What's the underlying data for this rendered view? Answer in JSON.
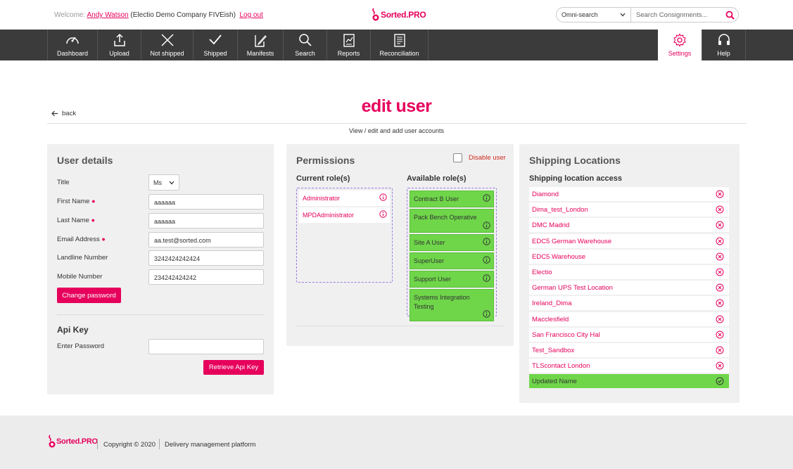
{
  "header": {
    "welcome": "Welcome:",
    "user_name": "Andy Watson",
    "company": "(Electio Demo Company FIVEish)",
    "logout": "Log out",
    "logo_text": "Sorted",
    "logo_pro": ".PRO",
    "omni_select": "Omni-search",
    "search_placeholder": "Search Consignments..."
  },
  "nav": {
    "items": [
      {
        "label": "Dashboard",
        "icon": "dashboard-icon"
      },
      {
        "label": "Upload",
        "icon": "upload-icon"
      },
      {
        "label": "Not shipped",
        "icon": "x-icon"
      },
      {
        "label": "Shipped",
        "icon": "check-icon"
      },
      {
        "label": "Manifests",
        "icon": "manifest-icon"
      },
      {
        "label": "Search",
        "icon": "search-icon"
      },
      {
        "label": "Reports",
        "icon": "reports-icon"
      },
      {
        "label": "Reconciliation",
        "icon": "reconciliation-icon"
      }
    ],
    "settings": "Settings",
    "help": "Help"
  },
  "page": {
    "back": "back",
    "title": "edit user",
    "subtitle": "View / edit and add user accounts"
  },
  "user_details": {
    "heading": "User details",
    "title_label": "Title",
    "title_value": "Ms",
    "first_name_label": "First Name",
    "first_name_value": "aaaaaa",
    "last_name_label": "Last Name",
    "last_name_value": "aaaaaa",
    "email_label": "Email Address",
    "email_value": "aa.test@sorted.com",
    "landline_label": "Landline Number",
    "landline_value": "3242424242424",
    "mobile_label": "Mobile Number",
    "mobile_value": "234242424242",
    "change_password": "Change password",
    "api_heading": "Api Key",
    "password_label": "Enter Password",
    "password_value": "",
    "retrieve_button": "Retrieve Api Key"
  },
  "permissions": {
    "heading": "Permissions",
    "disable_user": "Disable user",
    "current_heading": "Current role(s)",
    "available_heading": "Available role(s)",
    "current_roles": [
      "Administrator",
      "MPDAdministrator"
    ],
    "available_roles": [
      "Contract B User",
      "Pack Bench Operative",
      "Site A User",
      "SuperUser",
      "Support User",
      "Systems Integration Testing"
    ]
  },
  "shipping": {
    "heading": "Shipping Locations",
    "access_heading": "Shipping location access",
    "locations": [
      "Diamond",
      "Dima_test_London",
      "DMC Madrid",
      "EDC5 German Warehouse",
      "EDC5 Warehouse",
      "Electio",
      "German UPS Test Location",
      "Ireland_Dima",
      "Macclesfield",
      "San Francisco City Hal",
      "Test_Sandbox",
      "TLScontact London"
    ],
    "selected_location": "Updated Name"
  },
  "footer": {
    "logo_text": "Sorted",
    "logo_pro": ".PRO",
    "copyright": "Copyright © 2020",
    "tagline": "Delivery management platform"
  },
  "colors": {
    "brand": "#e6005c",
    "nav_bg": "#3b3b3b",
    "role_green": "#6fd64a"
  }
}
